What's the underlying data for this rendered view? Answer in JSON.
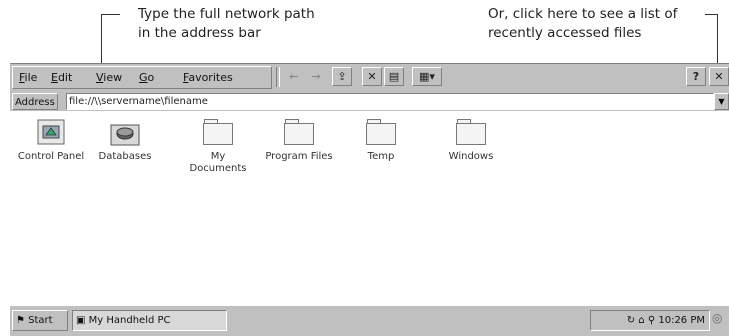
{
  "callouts": {
    "left": {
      "line1": "Type the full network path",
      "line2": "in the address bar"
    },
    "right": {
      "line1": "Or, click here to see a list of",
      "line2": "recently accessed files"
    }
  },
  "menubar": {
    "items": [
      "File",
      "Edit",
      "View",
      "Go",
      "Favorites"
    ]
  },
  "toolbar": {
    "back": "←",
    "forward": "→",
    "up": "⇪",
    "delete": "✕",
    "properties": "▤",
    "views": "▦▾",
    "help": "?",
    "close": "✕"
  },
  "address": {
    "label": "Address",
    "value": "file://\\\\servername\\filename",
    "dropdown": "▼"
  },
  "items": [
    {
      "label": "Control Panel",
      "icon": "control-panel-icon"
    },
    {
      "label": "Databases",
      "icon": "databases-icon"
    },
    {
      "label": "My Documents",
      "icon": "folder-icon"
    },
    {
      "label": "Program Files",
      "icon": "folder-icon"
    },
    {
      "label": "Temp",
      "icon": "folder-icon"
    },
    {
      "label": "Windows",
      "icon": "folder-icon"
    }
  ],
  "taskbar": {
    "start": "Start",
    "task": "My Handheld PC",
    "tray_icons": "↻ ⌂ ⚲",
    "time": "10:26 PM",
    "desktop": "◎"
  }
}
